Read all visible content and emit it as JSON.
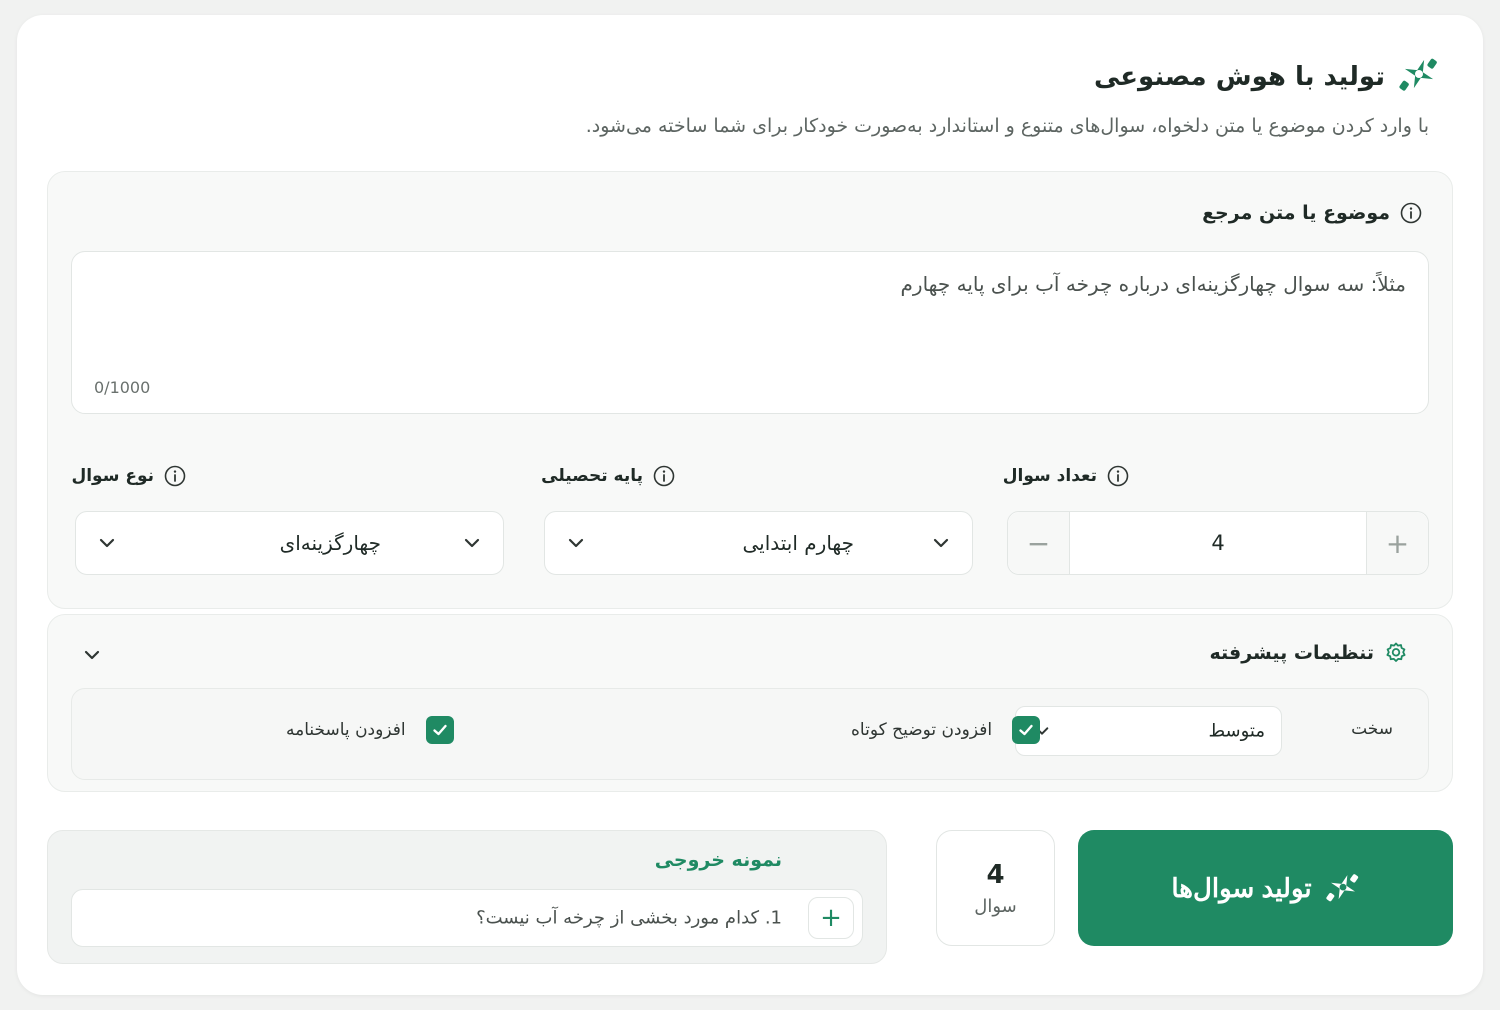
{
  "header": {
    "title": "تولید با هوش مصنوعی",
    "subtitle": "با وارد کردن موضوع یا متن دلخواه، سوال‌های متنوع و استاندارد به‌صورت خودکار برای شما ساخته می‌شود."
  },
  "topic": {
    "label": "موضوع یا متن مرجع",
    "placeholder": "مثلاً: سه سوال چهارگزینه‌ای درباره چرخه آب برای پایه چهارم",
    "value": "",
    "counter": "0/1000"
  },
  "question_count": {
    "label": "تعداد سوال",
    "value": "4",
    "minus": "−",
    "plus": "+"
  },
  "grade": {
    "label": "پایه تحصیلی",
    "value": "چهارم ابتدایی"
  },
  "question_type": {
    "label": "نوع سوال",
    "value": "چهارگزینه‌ای"
  },
  "advanced": {
    "label": "تنظیمات پیشرفته",
    "difficulty_label": "سخت",
    "difficulty_value": "متوسط",
    "add_explanation": {
      "label": "افزودن توضیح کوتاه",
      "checked": true
    },
    "add_answer_key": {
      "label": "افزودن پاسخنامه",
      "checked": true
    }
  },
  "generate_button": {
    "label": "تولید سوال‌ها"
  },
  "summary": {
    "count": "4",
    "unit": "سوال"
  },
  "sample": {
    "title": "نمونه خروجی",
    "item": "1. کدام مورد بخشی از چرخه آب نیست؟",
    "add": "+"
  },
  "colors": {
    "accent": "#1f8a63",
    "text": "#1f2a26",
    "muted": "#5d6562"
  }
}
